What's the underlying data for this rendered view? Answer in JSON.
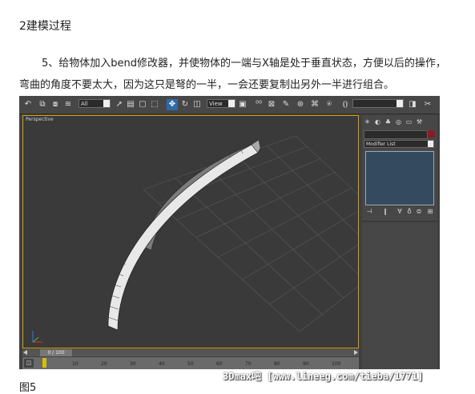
{
  "article": {
    "heading": "2建模过程",
    "paragraph_line1": "5、给物体加入bend修改器，并使物体的一端与X轴是处于垂直状态，方便以后的操作，",
    "paragraph_line2": "弯曲的角度不要太大，因为这只是弩的一半，一会还要复制出另外一半进行组合。",
    "figure_caption": "图5",
    "watermark": "3Dmax吧 [www.lineeg.com/tieba/1771]"
  },
  "toolbar": {
    "selection_filter": "All",
    "coord_system": "View",
    "active_tool": "select-and-move"
  },
  "viewport": {
    "label": "Perspective",
    "border_color": "#d6a200"
  },
  "command_panel": {
    "modifier_list_label": "Modifier List",
    "color_swatch": "#8a1b24"
  },
  "timeline": {
    "frame_readout": "0 / 100",
    "ticks": [
      "10",
      "20",
      "30",
      "40",
      "50",
      "60",
      "70",
      "80",
      "90",
      "100"
    ]
  },
  "icons": [
    "undo-icon",
    "link-icon",
    "unlink-icon",
    "bind-icon",
    "select-icon",
    "select-by-name-icon",
    "rect-region-icon",
    "window-crossing-icon",
    "move-icon",
    "rotate-icon",
    "scale-icon",
    "pivot-icon",
    "mirror-icon",
    "align-icon",
    "snap-icon",
    "angle-snap-icon",
    "percent-snap-icon",
    "spinner-snap-icon",
    "named-selection-icon",
    "render-icon",
    "quick-render-icon"
  ]
}
